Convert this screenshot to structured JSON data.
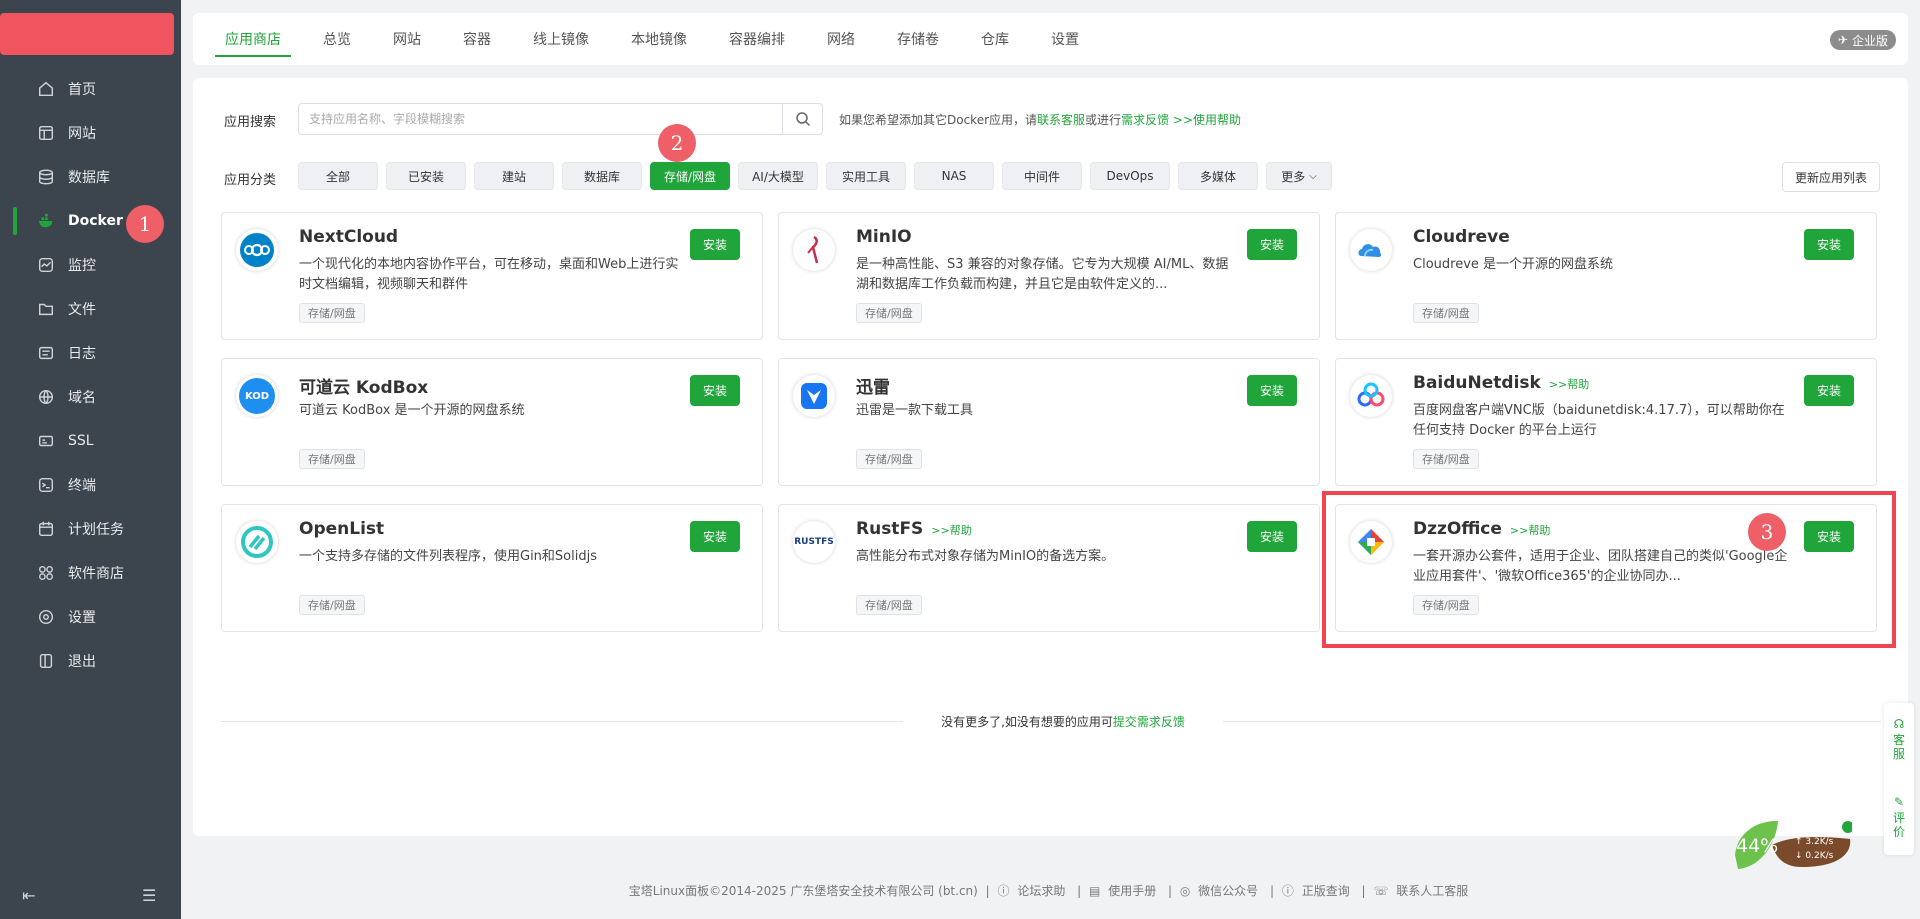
{
  "sidebar": {
    "items": [
      {
        "label": "首页",
        "icon": "home-icon"
      },
      {
        "label": "网站",
        "icon": "website-icon"
      },
      {
        "label": "数据库",
        "icon": "database-icon"
      },
      {
        "label": "Docker",
        "icon": "docker-icon",
        "active": true
      },
      {
        "label": "监控",
        "icon": "monitor-icon"
      },
      {
        "label": "文件",
        "icon": "folder-icon"
      },
      {
        "label": "日志",
        "icon": "log-icon"
      },
      {
        "label": "域名",
        "icon": "globe-icon"
      },
      {
        "label": "SSL",
        "icon": "ssl-icon"
      },
      {
        "label": "终端",
        "icon": "terminal-icon"
      },
      {
        "label": "计划任务",
        "icon": "calendar-icon"
      },
      {
        "label": "软件商店",
        "icon": "app-store-icon"
      },
      {
        "label": "设置",
        "icon": "gear-icon"
      },
      {
        "label": "退出",
        "icon": "logout-icon"
      }
    ]
  },
  "badges": {
    "one": "1",
    "two": "2",
    "three": "3"
  },
  "topnav": {
    "tabs": [
      {
        "label": "应用商店",
        "active": true
      },
      {
        "label": "总览"
      },
      {
        "label": "网站"
      },
      {
        "label": "容器"
      },
      {
        "label": "线上镜像"
      },
      {
        "label": "本地镜像"
      },
      {
        "label": "容器编排"
      },
      {
        "label": "网络"
      },
      {
        "label": "存储卷"
      },
      {
        "label": "仓库"
      },
      {
        "label": "设置"
      }
    ],
    "enterprise": "企业版"
  },
  "search": {
    "label": "应用搜索",
    "placeholder": "支持应用名称、字段模糊搜索",
    "hint_prefix": "如果您希望添加其它Docker应用，请",
    "hint_link1": "联系客服",
    "hint_mid": "或进行",
    "hint_link2": "需求反馈",
    "hint_link3": ">>使用帮助"
  },
  "categories": {
    "label": "应用分类",
    "items": [
      "全部",
      "已安装",
      "建站",
      "数据库",
      "存储/网盘",
      "AI/大模型",
      "实用工具",
      "NAS",
      "中间件",
      "DevOps",
      "多媒体",
      "更多"
    ],
    "active": "存储/网盘",
    "update_button": "更新应用列表"
  },
  "apps": [
    {
      "name": "NextCloud",
      "help": "",
      "desc": "一个现代化的本地内容协作平台，可在移动，桌面和Web上进行实时文档编辑，视频聊天和群件",
      "tag": "存储/网盘",
      "install": "安装",
      "icon": "nextcloud-icon"
    },
    {
      "name": "MinIO",
      "help": "",
      "desc": "是一种高性能、S3 兼容的对象存储。它专为大规模 AI/ML、数据湖和数据库工作负载而构建，并且它是由软件定义的...",
      "tag": "存储/网盘",
      "install": "安装",
      "icon": "minio-icon"
    },
    {
      "name": "Cloudreve",
      "help": "",
      "desc": "Cloudreve 是一个开源的网盘系统",
      "tag": "存储/网盘",
      "install": "安装",
      "icon": "cloudreve-icon"
    },
    {
      "name": "可道云 KodBox",
      "help": "",
      "desc": "可道云 KodBox 是一个开源的网盘系统",
      "tag": "存储/网盘",
      "install": "安装",
      "icon": "kodbox-icon"
    },
    {
      "name": "迅雷",
      "help": "",
      "desc": "迅雷是一款下载工具",
      "tag": "存储/网盘",
      "install": "安装",
      "icon": "xunlei-icon"
    },
    {
      "name": "BaiduNetdisk",
      "help": ">>帮助",
      "desc": "百度网盘客户端VNC版（baidunetdisk:4.17.7），可以帮助你在任何支持 Docker 的平台上运行",
      "tag": "存储/网盘",
      "install": "安装",
      "icon": "baidunetdisk-icon"
    },
    {
      "name": "OpenList",
      "help": "",
      "desc": "一个支持多存储的文件列表程序，使用Gin和Solidjs",
      "tag": "存储/网盘",
      "install": "安装",
      "icon": "openlist-icon"
    },
    {
      "name": "RustFS",
      "help": ">>帮助",
      "desc": "高性能分布式对象存储为MinIO的备选方案。",
      "tag": "存储/网盘",
      "install": "安装",
      "icon": "rustfs-icon"
    },
    {
      "name": "DzzOffice",
      "help": ">>帮助",
      "desc": "一套开源办公套件，适用于企业、团队搭建自己的类似'Google企业应用套件'、'微软Office365'的企业协同办...",
      "tag": "存储/网盘",
      "install": "安装",
      "icon": "dzzoffice-icon"
    }
  ],
  "nomore": {
    "text": "没有更多了,如没有想要的应用可",
    "link": "提交需求反馈"
  },
  "footer": {
    "copyright": "宝塔Linux面板©2014-2025 广东堡塔安全技术有限公司 (bt.cn)",
    "links": [
      "论坛求助",
      "使用手册",
      "微信公众号",
      "正版查询",
      "联系人工客服"
    ]
  },
  "side_widget": {
    "service": "客服",
    "review": "评价"
  },
  "monitor": {
    "percent": "44%",
    "up": "3.2K/s",
    "down": "0.2K/s"
  },
  "rustfs_logo_text": "RUSTFS",
  "kodbox_logo_text": "KOD"
}
